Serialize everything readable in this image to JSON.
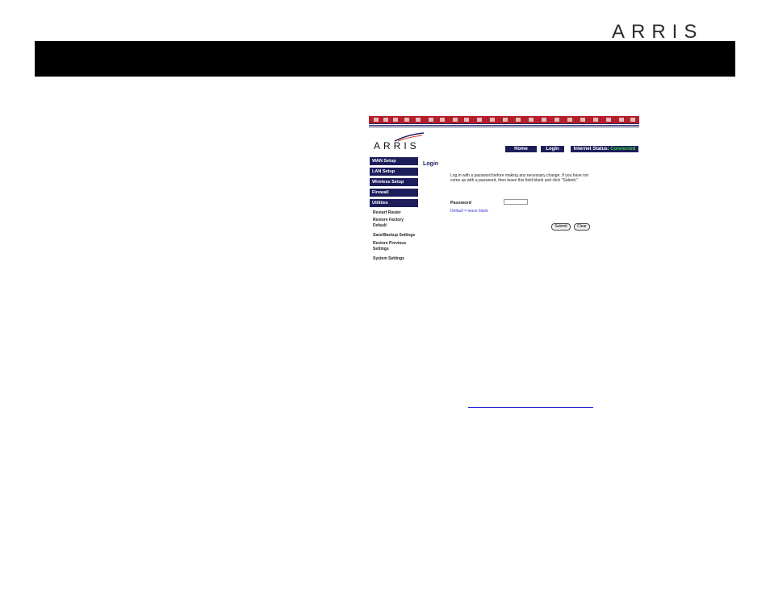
{
  "header": {
    "brand": "ARRIS"
  },
  "screenshot": {
    "brand": "ARRIS",
    "nav": {
      "home": "Home",
      "login": "Login",
      "status_label": "Internet Status:",
      "status_value": "Connected"
    },
    "sidebar": {
      "items": [
        "WAN Setup",
        "LAN Setup",
        "Wireless Setup",
        "Firewall",
        "Utilities"
      ],
      "subitems": [
        "Restart Router",
        "Restore Factory Default",
        "Save/Backup Settings",
        "Restore Previous Settings",
        "System Settings"
      ]
    },
    "login": {
      "title": "Login",
      "description": "Log in with a password before making any necessary change. If you have not come up with a password, then leave this field blank and click \"Submit.\"",
      "password_label": "Password",
      "password_value": "",
      "default_hint": "Default = leave blank",
      "submit": "Submit",
      "clear": "Clear"
    },
    "colors": {
      "navy": "#1d1d5c",
      "stripe_red": "#b3202a",
      "connected_green": "#40d040",
      "link_blue": "#3b3bd0"
    }
  }
}
